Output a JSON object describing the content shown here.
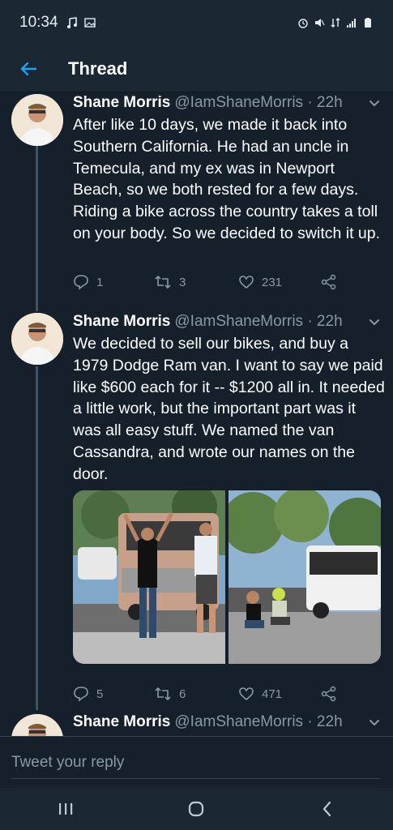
{
  "status_bar": {
    "time": "10:34"
  },
  "header": {
    "title": "Thread"
  },
  "tweets": [
    {
      "name": "Shane Morris",
      "handle": "@IamShaneMorris · 22h",
      "text": "After like 10 days, we made it back into Southern California. He had an uncle in Temecula, and my ex was in Newport Beach, so we both rested for a few days. Riding a bike across the country takes a toll on your body. So we decided to switch it up.",
      "replies": "1",
      "retweets": "3",
      "likes": "231"
    },
    {
      "name": "Shane Morris",
      "handle": "@IamShaneMorris · 22h",
      "text": "We decided to sell our bikes, and buy a 1979 Dodge Ram van. I want to say we paid like $600 each for it -- $1200 all in. It needed a little work, but the important part was it was all easy stuff. We named the van Cassandra, and wrote our names on the door.",
      "replies": "5",
      "retweets": "6",
      "likes": "471"
    },
    {
      "name": "Shane Morris",
      "handle": "@IamShaneMorris · 22h"
    }
  ],
  "reply": {
    "placeholder": "Tweet your reply"
  },
  "colors": {
    "background": "#15202b",
    "bar": "#1b2733",
    "accent": "#1da1f2",
    "muted": "#8899a6"
  },
  "icons": [
    "back-arrow-icon",
    "chevron-down-icon",
    "reply-icon",
    "retweet-icon",
    "like-icon",
    "share-icon",
    "recents-icon",
    "home-icon",
    "back-icon"
  ]
}
